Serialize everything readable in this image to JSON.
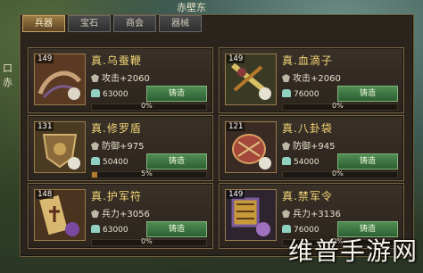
{
  "map": {
    "title": "赤壁东",
    "left_labels": [
      "口",
      "赤"
    ]
  },
  "tabs": [
    {
      "label": "兵器",
      "active": true
    },
    {
      "label": "宝石",
      "active": false
    },
    {
      "label": "商会",
      "active": false
    },
    {
      "label": "器械",
      "active": false
    }
  ],
  "cards": [
    {
      "level": "149",
      "name": "真.乌蚕鞭",
      "stat": "攻击+2060",
      "cost": "63000",
      "button": "铸造",
      "progress_pct": "0%",
      "progress": 0
    },
    {
      "level": "149",
      "name": "真.血滴子",
      "stat": "攻击+2060",
      "cost": "76000",
      "button": "铸造",
      "progress_pct": "0%",
      "progress": 0
    },
    {
      "level": "131",
      "name": "真.修罗盾",
      "stat": "防御+975",
      "cost": "50400",
      "button": "铸造",
      "progress_pct": "5%",
      "progress": 0.05
    },
    {
      "level": "121",
      "name": "真.八卦袋",
      "stat": "防御+945",
      "cost": "54000",
      "button": "铸造",
      "progress_pct": "0%",
      "progress": 0
    },
    {
      "level": "148",
      "name": "真.护军符",
      "stat": "兵力+3056",
      "cost": "63000",
      "button": "铸造",
      "progress_pct": "0%",
      "progress": 0
    },
    {
      "level": "149",
      "name": "真.禁军令",
      "stat": "兵力+3136",
      "cost": "76000",
      "button": "铸造",
      "progress_pct": "0%",
      "progress": 0
    }
  ],
  "watermark": "维普手游网",
  "colors": {
    "name": "#f2d476",
    "button": "#3f7a45",
    "progress": "#b27b2c"
  }
}
